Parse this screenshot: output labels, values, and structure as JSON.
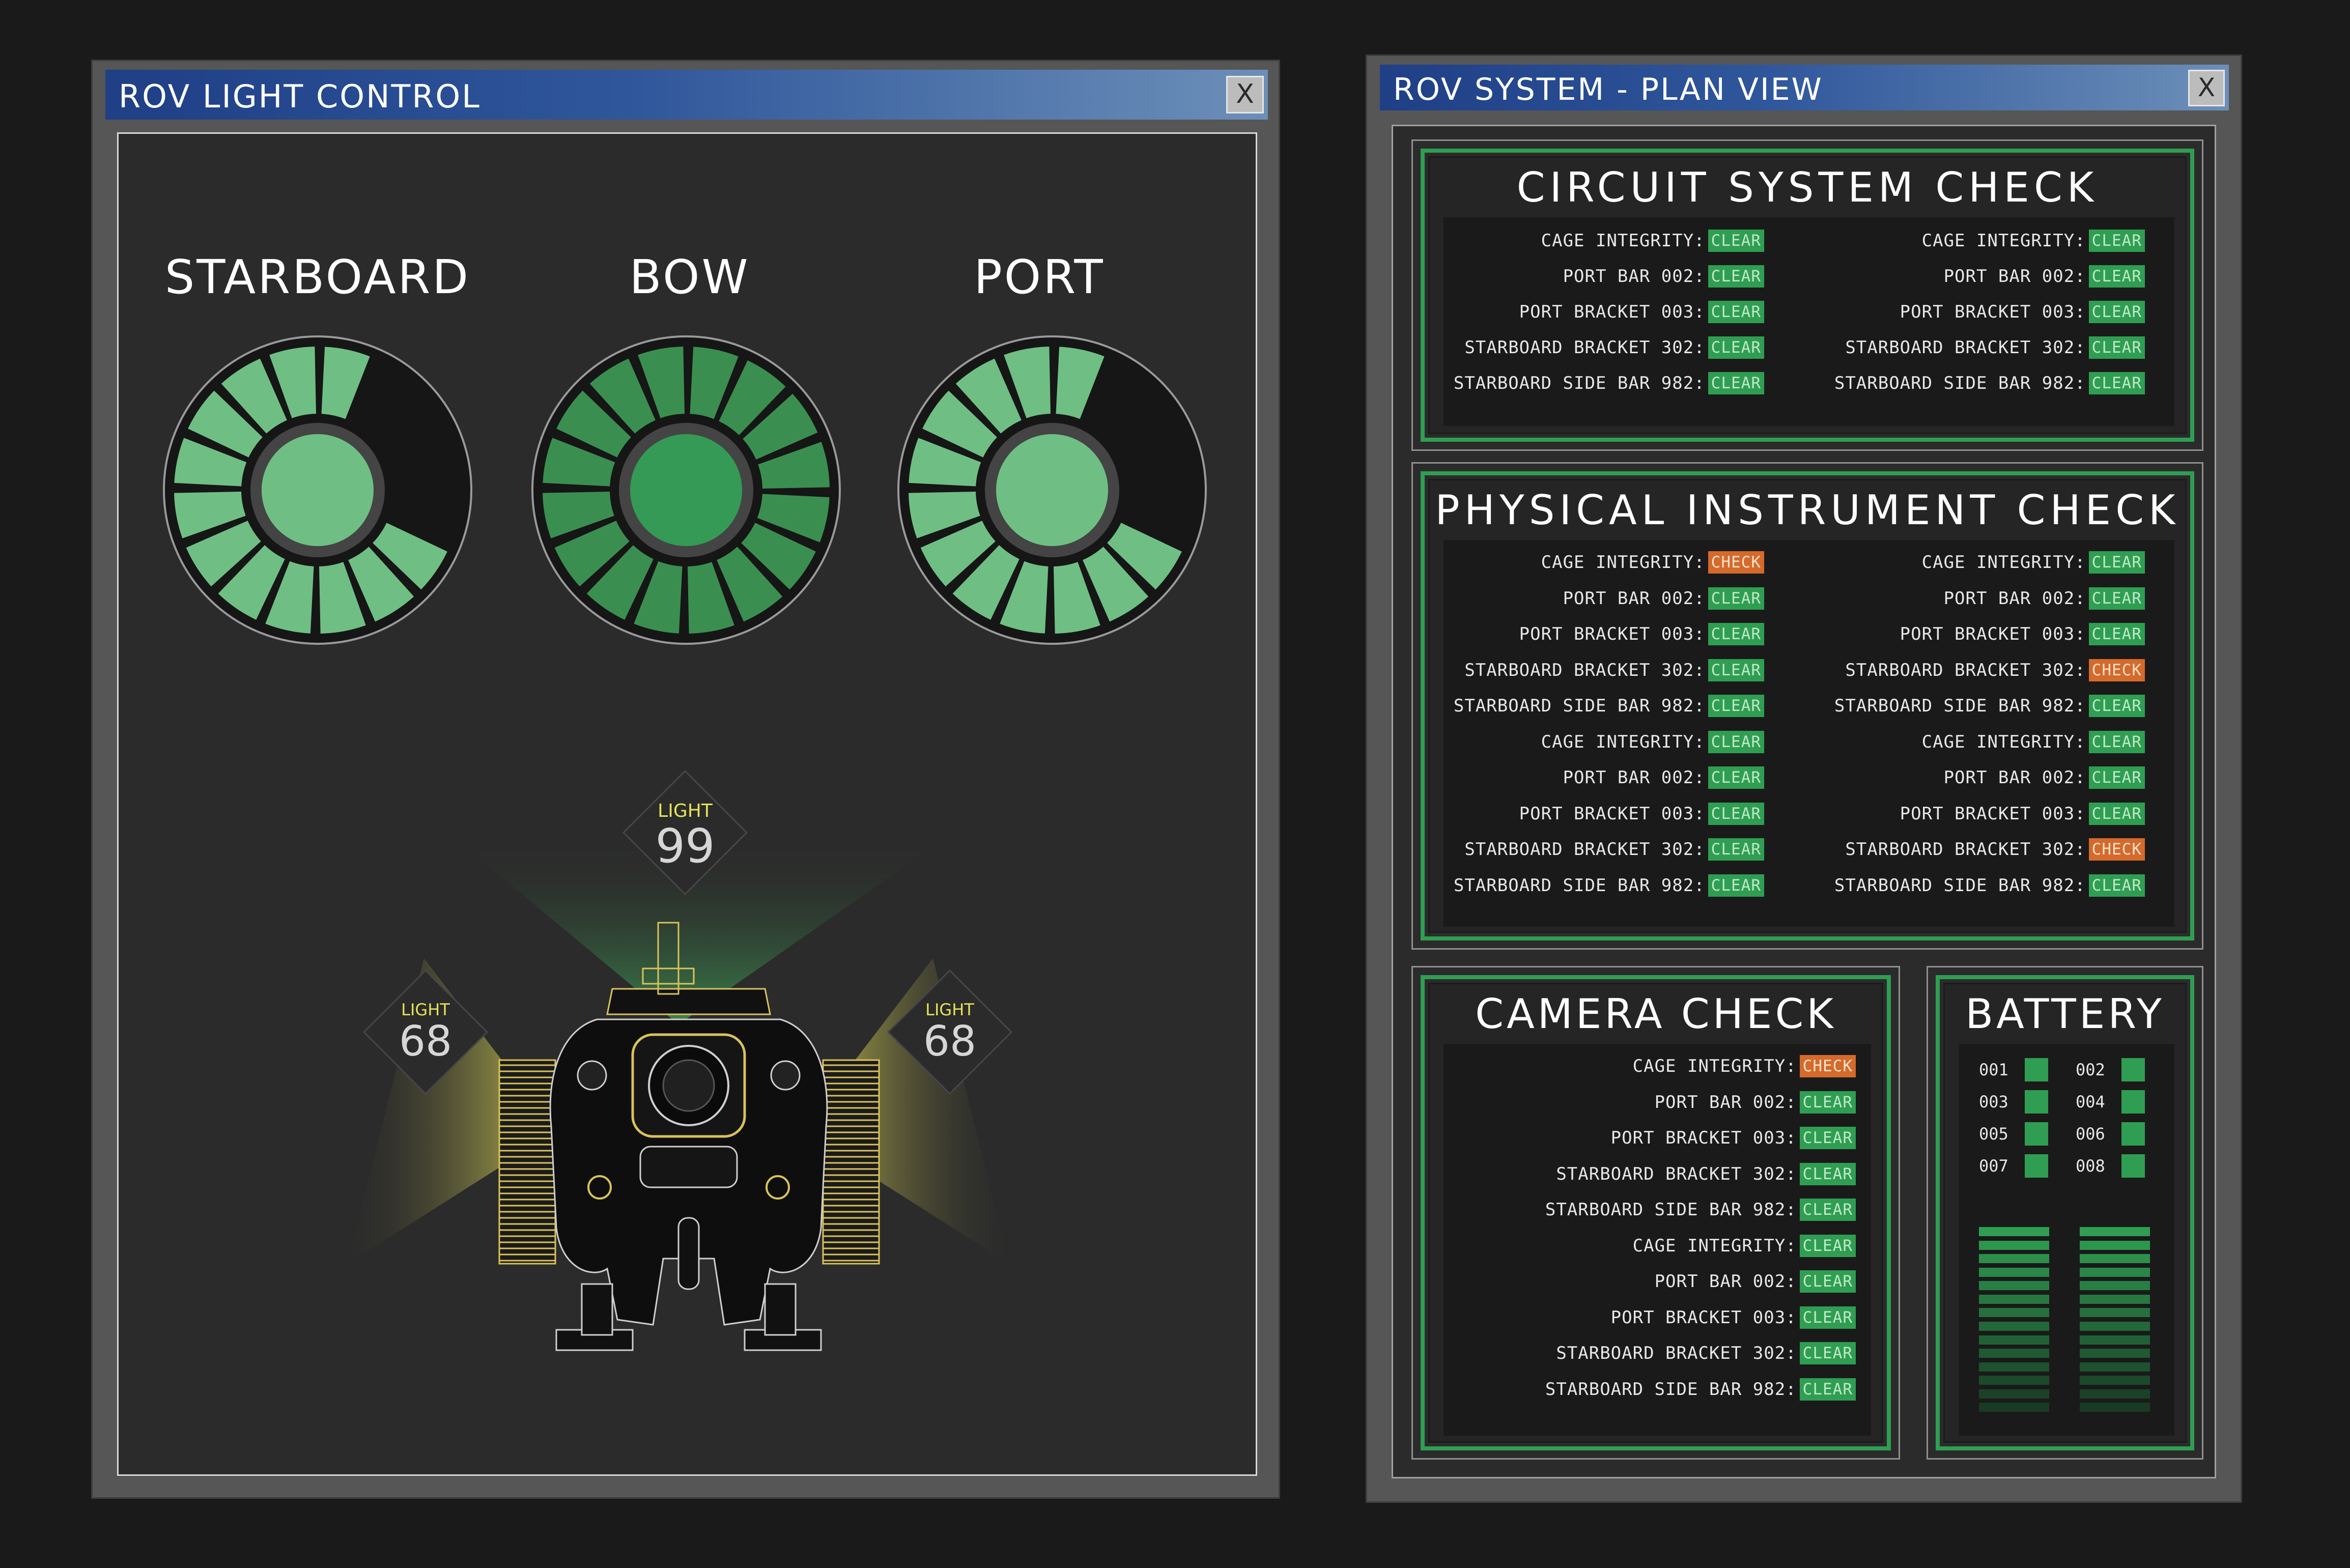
{
  "light_window": {
    "title": "ROV LIGHT CONTROL",
    "close_label": "X",
    "dials": [
      {
        "label": "STARBOARD",
        "level": 0.75
      },
      {
        "label": "BOW",
        "level": 1.0
      },
      {
        "label": "PORT",
        "level": 0.75
      }
    ],
    "lights": [
      {
        "label": "LIGHT",
        "value": "99"
      },
      {
        "label": "LIGHT",
        "value": "68"
      },
      {
        "label": "LIGHT",
        "value": "68"
      }
    ],
    "colors": {
      "accent_green": "#6fbf84",
      "dark_green": "#2f9e52",
      "yellow": "#e7e35a"
    }
  },
  "system_window": {
    "title": "ROV SYSTEM - PLAN VIEW",
    "close_label": "X",
    "circuit": {
      "title": "CIRCUIT SYSTEM CHECK",
      "left": [
        {
          "label": "CAGE INTEGRITY:",
          "status": "CLEAR"
        },
        {
          "label": "PORT BAR 002:",
          "status": "CLEAR"
        },
        {
          "label": "PORT BRACKET 003:",
          "status": "CLEAR"
        },
        {
          "label": "STARBOARD BRACKET 302:",
          "status": "CLEAR"
        },
        {
          "label": "STARBOARD SIDE BAR 982:",
          "status": "CLEAR"
        }
      ],
      "right": [
        {
          "label": "CAGE INTEGRITY:",
          "status": "CLEAR"
        },
        {
          "label": "PORT BAR 002:",
          "status": "CLEAR"
        },
        {
          "label": "PORT BRACKET 003:",
          "status": "CLEAR"
        },
        {
          "label": "STARBOARD BRACKET 302:",
          "status": "CLEAR"
        },
        {
          "label": "STARBOARD SIDE BAR 982:",
          "status": "CLEAR"
        }
      ]
    },
    "physical": {
      "title": "PHYSICAL INSTRUMENT CHECK",
      "left": [
        {
          "label": "CAGE INTEGRITY:",
          "status": "CHECK"
        },
        {
          "label": "PORT BAR 002:",
          "status": "CLEAR"
        },
        {
          "label": "PORT BRACKET 003:",
          "status": "CLEAR"
        },
        {
          "label": "STARBOARD BRACKET 302:",
          "status": "CLEAR"
        },
        {
          "label": "STARBOARD SIDE BAR 982:",
          "status": "CLEAR"
        },
        {
          "label": "CAGE INTEGRITY:",
          "status": "CLEAR"
        },
        {
          "label": "PORT BAR 002:",
          "status": "CLEAR"
        },
        {
          "label": "PORT BRACKET 003:",
          "status": "CLEAR"
        },
        {
          "label": "STARBOARD BRACKET 302:",
          "status": "CLEAR"
        },
        {
          "label": "STARBOARD SIDE BAR 982:",
          "status": "CLEAR"
        }
      ],
      "right": [
        {
          "label": "CAGE INTEGRITY:",
          "status": "CLEAR"
        },
        {
          "label": "PORT BAR 002:",
          "status": "CLEAR"
        },
        {
          "label": "PORT BRACKET 003:",
          "status": "CLEAR"
        },
        {
          "label": "STARBOARD BRACKET 302:",
          "status": "CHECK"
        },
        {
          "label": "STARBOARD SIDE BAR 982:",
          "status": "CLEAR"
        },
        {
          "label": "CAGE INTEGRITY:",
          "status": "CLEAR"
        },
        {
          "label": "PORT BAR 002:",
          "status": "CLEAR"
        },
        {
          "label": "PORT BRACKET 003:",
          "status": "CLEAR"
        },
        {
          "label": "STARBOARD BRACKET 302:",
          "status": "CHECK"
        },
        {
          "label": "STARBOARD SIDE BAR 982:",
          "status": "CLEAR"
        }
      ]
    },
    "camera": {
      "title": "CAMERA CHECK",
      "rows": [
        {
          "label": "CAGE INTEGRITY:",
          "status": "CHECK"
        },
        {
          "label": "PORT BAR 002:",
          "status": "CLEAR"
        },
        {
          "label": "PORT BRACKET 003:",
          "status": "CLEAR"
        },
        {
          "label": "STARBOARD BRACKET 302:",
          "status": "CLEAR"
        },
        {
          "label": "STARBOARD SIDE BAR 982:",
          "status": "CLEAR"
        },
        {
          "label": "CAGE INTEGRITY:",
          "status": "CLEAR"
        },
        {
          "label": "PORT BAR 002:",
          "status": "CLEAR"
        },
        {
          "label": "PORT BRACKET 003:",
          "status": "CLEAR"
        },
        {
          "label": "STARBOARD BRACKET 302:",
          "status": "CLEAR"
        },
        {
          "label": "STARBOARD SIDE BAR 982:",
          "status": "CLEAR"
        }
      ]
    },
    "battery": {
      "title": "BATTERY",
      "cells": [
        "001",
        "002",
        "003",
        "004",
        "005",
        "006",
        "007",
        "008"
      ],
      "gauges": [
        {
          "level": 1.0
        },
        {
          "level": 1.0
        }
      ],
      "colors": {
        "ok": "#2f9e52",
        "check": "#d46a2c"
      }
    }
  }
}
